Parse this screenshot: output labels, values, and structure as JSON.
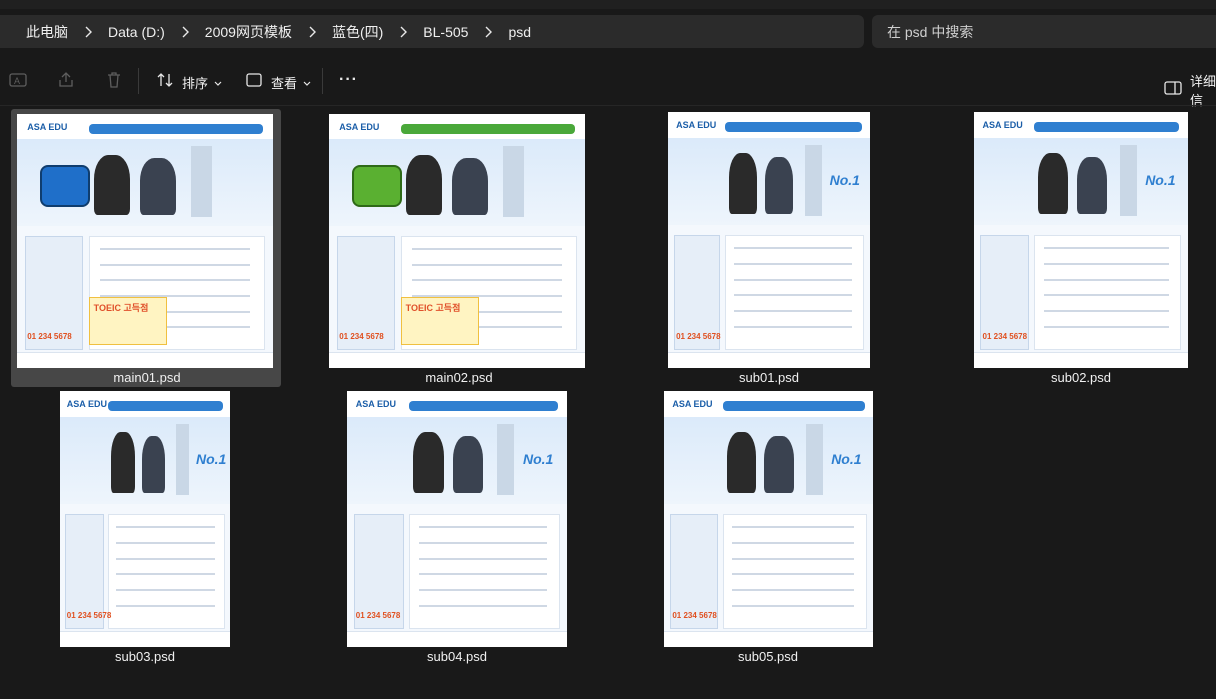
{
  "breadcrumbs": [
    "此电脑",
    "Data (D:)",
    "2009网页模板",
    "蓝色(四)",
    "BL-505",
    "psd"
  ],
  "search": {
    "placeholder": "在 psd 中搜索"
  },
  "toolbar": {
    "sort_label": "排序",
    "view_label": "查看",
    "more_label": "···",
    "details_label": "详细信"
  },
  "thumb_text": {
    "logo": "ASA EDU",
    "badge": "TOEIC 고득점",
    "phone": "01 234 5678",
    "no1": "No.1"
  },
  "files": [
    {
      "name": "main01.psd",
      "variant": "main-blue",
      "selected": true
    },
    {
      "name": "main02.psd",
      "variant": "main-green",
      "selected": false
    },
    {
      "name": "sub01.psd",
      "variant": "sub",
      "selected": false
    },
    {
      "name": "sub02.psd",
      "variant": "sub",
      "selected": false
    },
    {
      "name": "sub03.psd",
      "variant": "sub",
      "selected": false
    },
    {
      "name": "sub04.psd",
      "variant": "sub",
      "selected": false
    },
    {
      "name": "sub05.psd",
      "variant": "sub",
      "selected": false
    }
  ],
  "colors": {
    "background": "#191919",
    "bar": "#2b2b2b",
    "selection": "#474747",
    "accent_blue": "#2f7fd0",
    "accent_green": "#4aa83a"
  }
}
